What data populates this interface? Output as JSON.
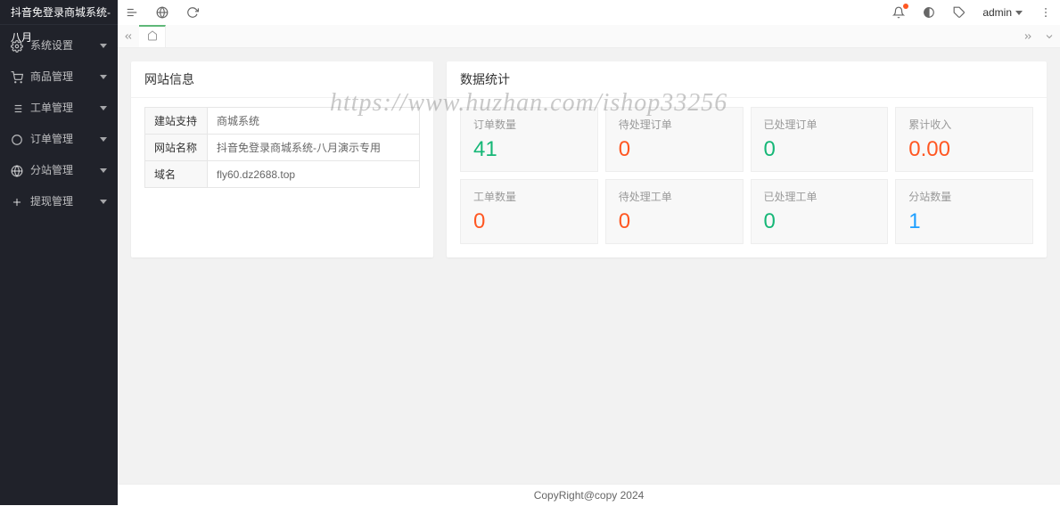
{
  "app": {
    "title": "抖音免登录商城系统-八月"
  },
  "sidebar": {
    "items": [
      {
        "label": "系统设置",
        "icon": "gear-icon"
      },
      {
        "label": "商品管理",
        "icon": "cart-icon"
      },
      {
        "label": "工单管理",
        "icon": "list-icon"
      },
      {
        "label": "订单管理",
        "icon": "circle-icon"
      },
      {
        "label": "分站管理",
        "icon": "globe-icon"
      },
      {
        "label": "提现管理",
        "icon": "plus-icon"
      }
    ]
  },
  "topbar": {
    "user": "admin"
  },
  "website_info": {
    "title": "网站信息",
    "rows": [
      {
        "label": "建站支持",
        "value": "商城系统"
      },
      {
        "label": "网站名称",
        "value": "抖音免登录商城系统-八月演示专用"
      },
      {
        "label": "域名",
        "value": "fly60.dz2688.top"
      }
    ]
  },
  "stats": {
    "title": "数据统计",
    "items": [
      {
        "label": "订单数量",
        "value": "41",
        "color": "green"
      },
      {
        "label": "待处理订单",
        "value": "0",
        "color": "red"
      },
      {
        "label": "已处理订单",
        "value": "0",
        "color": "green"
      },
      {
        "label": "累计收入",
        "value": "0.00",
        "color": "red"
      },
      {
        "label": "工单数量",
        "value": "0",
        "color": "red"
      },
      {
        "label": "待处理工单",
        "value": "0",
        "color": "red"
      },
      {
        "label": "已处理工单",
        "value": "0",
        "color": "green"
      },
      {
        "label": "分站数量",
        "value": "1",
        "color": "blue"
      }
    ]
  },
  "footer": {
    "text": "CopyRight@copy 2024"
  },
  "watermark": "https://www.huzhan.com/ishop33256"
}
